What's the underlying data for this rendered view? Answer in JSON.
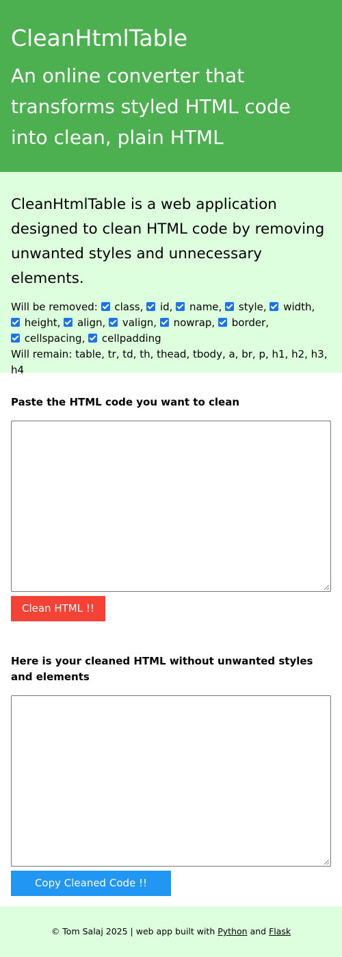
{
  "header": {
    "title": "CleanHtmlTable",
    "subtitle": "An online converter that transforms styled HTML code into clean, plain HTML"
  },
  "info": {
    "description": "CleanHtmlTable is a web application designed to clean HTML code by removing unwanted styles and unnecessary elements.",
    "removed_label": "Will be removed:",
    "options": [
      {
        "label": "class,",
        "checked": true
      },
      {
        "label": "id,",
        "checked": true
      },
      {
        "label": "name,",
        "checked": true
      },
      {
        "label": "style,",
        "checked": true
      },
      {
        "label": "width,",
        "checked": true
      },
      {
        "label": "height,",
        "checked": true
      },
      {
        "label": "align,",
        "checked": true
      },
      {
        "label": "valign,",
        "checked": true
      },
      {
        "label": "nowrap,",
        "checked": true
      },
      {
        "label": "border,",
        "checked": true
      },
      {
        "label": "cellspacing,",
        "checked": true
      },
      {
        "label": "cellpadding",
        "checked": true
      }
    ],
    "remain_text": "Will remain: table, tr, td, th, thead, tbody, a, br, p, h1, h2, h3, h4"
  },
  "input_section": {
    "label": "Paste the HTML code you want to clean",
    "value": "",
    "button_label": "Clean HTML !!"
  },
  "output_section": {
    "label": "Here is your cleaned HTML without unwanted styles and elements",
    "value": "",
    "button_label": "Copy Cleaned Code !!"
  },
  "footer": {
    "prefix": "© Tom Salaj 2025 | web app built with",
    "link_python": "Python",
    "and": "and",
    "link_flask": "Flask"
  },
  "colors": {
    "header_bg": "#4caf50",
    "info_bg": "#ddffdd",
    "clean_button": "#f44336",
    "copy_button": "#2196f3",
    "checkbox": "#1a73e8"
  }
}
